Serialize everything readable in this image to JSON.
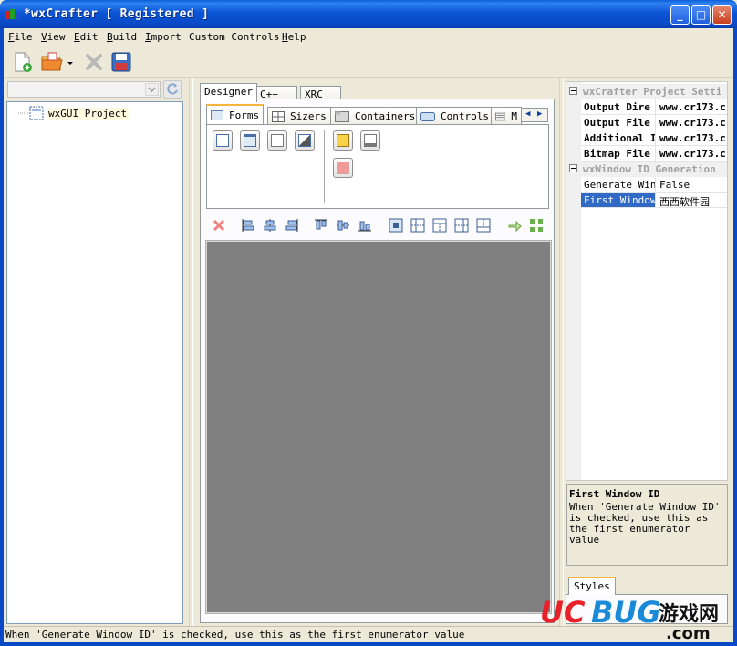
{
  "window": {
    "title": "*wxCrafter [ Registered ]",
    "minimize": "_",
    "maximize": "□",
    "close": "✕"
  },
  "menu": [
    {
      "pre": "",
      "key": "F",
      "post": "ile"
    },
    {
      "pre": "",
      "key": "V",
      "post": "iew"
    },
    {
      "pre": "",
      "key": "E",
      "post": "dit"
    },
    {
      "pre": "",
      "key": "B",
      "post": "uild"
    },
    {
      "pre": "",
      "key": "I",
      "post": "mport"
    },
    {
      "pre": "Custom Controls",
      "key": "",
      "post": ""
    },
    {
      "pre": "",
      "key": "H",
      "post": "elp"
    }
  ],
  "toolbar": {
    "icons": [
      "new-file-icon",
      "open-folder-icon",
      "dropdown-arrow-icon",
      "delete-icon",
      "save-icon"
    ]
  },
  "tree": {
    "root_label": "wxGUI Project"
  },
  "center_tabs": [
    "Designer",
    "C++",
    "XRC"
  ],
  "palette_tabs": [
    "Forms",
    "Sizers",
    "Containers",
    "Controls",
    "M"
  ],
  "properties": {
    "cat1": "wxCrafter Project Setti",
    "rows1": [
      {
        "k": "Output Dire",
        "v": "www.cr173.c"
      },
      {
        "k": "Output File",
        "v": "www.cr173.c"
      },
      {
        "k": "Additional I",
        "v": "www.cr173.c"
      },
      {
        "k": "Bitmap File",
        "v": "www.cr173.c"
      }
    ],
    "cat2": "wxWindow ID Generation",
    "rows2": [
      {
        "k": "Generate Wind",
        "v": "False"
      },
      {
        "k": "First Window",
        "v": "西西软件园"
      }
    ]
  },
  "help": {
    "title": "First Window ID",
    "desc": "When 'Generate Window ID' is checked, use this as the first enumerator value"
  },
  "styles_tab": "Styles",
  "status": "When 'Generate Window ID' is checked, use this as the first enumerator value",
  "watermark": {
    "uc": "UC",
    "bug": "BUG",
    "cn": "游戏网",
    "com": ".com"
  },
  "colors": {
    "titlebar": "#0a49c6",
    "canvas": "#808080",
    "selected": "#316ac5",
    "tab_accent": "#f6b33d"
  }
}
